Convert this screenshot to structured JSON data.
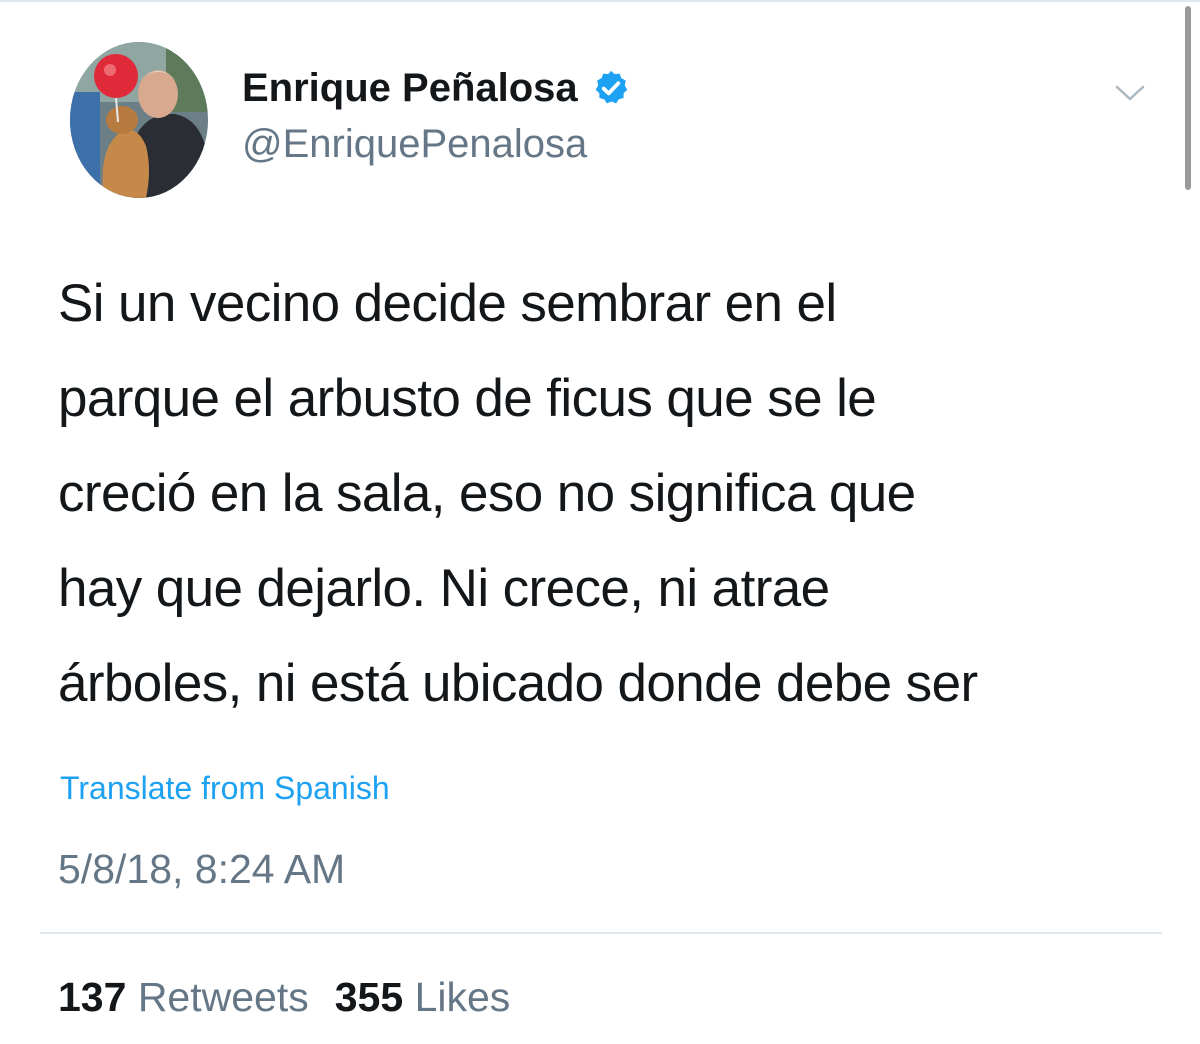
{
  "author": {
    "display_name": "Enrique Peñalosa",
    "handle": "@EnriquePenalosa",
    "verified": true,
    "avatar_icon": "profile-photo"
  },
  "tweet": {
    "lines": [
      "Si un vecino decide sembrar en el",
      "parque el arbusto de ficus que se le",
      "creció en la sala, eso no significa que",
      "hay que dejarlo. Ni crece, ni atrae",
      "árboles, ni está ubicado donde debe ser"
    ]
  },
  "translate_label": "Translate from Spanish",
  "timestamp": "5/8/18, 8:24 AM",
  "stats": {
    "retweets_count": "137",
    "retweets_label": "Retweets",
    "likes_count": "355",
    "likes_label": "Likes"
  },
  "icons": {
    "verified": "verified-badge-icon",
    "menu": "chevron-down-icon"
  },
  "colors": {
    "accent": "#1da1f2",
    "text": "#14171a",
    "secondary": "#657786",
    "divider": "#e1e8ed"
  }
}
